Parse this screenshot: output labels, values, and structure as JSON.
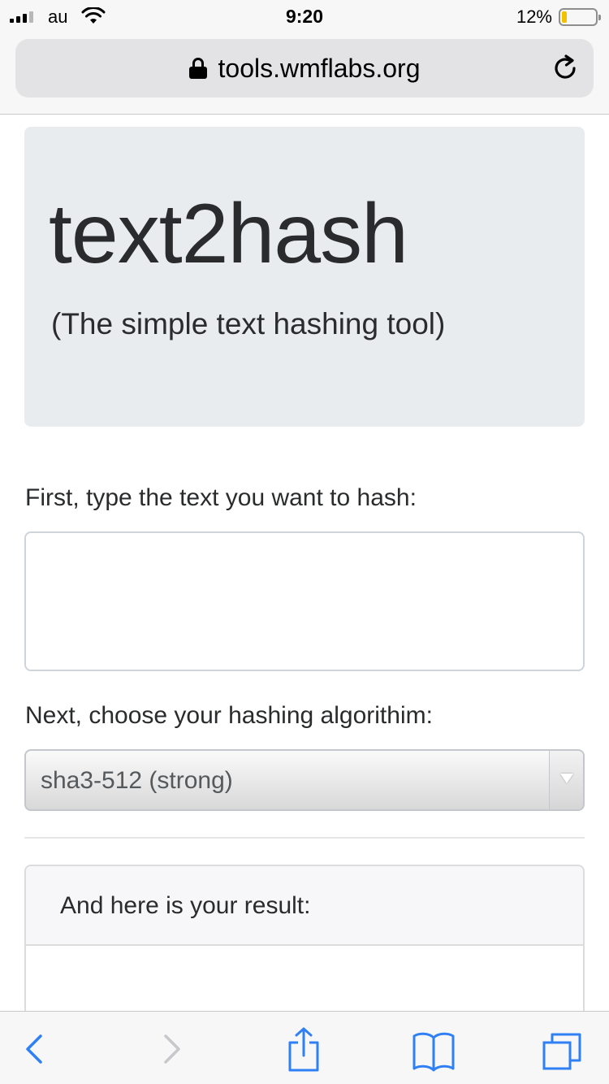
{
  "status_bar": {
    "carrier": "au",
    "time": "9:20",
    "battery_percent": "12%",
    "battery_level": 0.12
  },
  "browser": {
    "url": "tools.wmflabs.org"
  },
  "page": {
    "title": "text2hash",
    "subtitle": "(The simple text hashing tool)",
    "input_label": "First, type the text you want to hash:",
    "input_value": "",
    "algorithm_label": "Next, choose your hashing algorithim:",
    "algorithm_selected": "sha3-512 (strong)",
    "result_label": "And here is your result:",
    "result_value": ""
  },
  "colors": {
    "accent": "#2f7ff5",
    "accent_disabled": "#c7c7cc",
    "jumbotron_bg": "#e9ecef",
    "battery_low": "#f2c200"
  },
  "icons": {
    "back": "chevron-left-icon",
    "forward": "chevron-right-icon",
    "share": "share-icon",
    "bookmarks": "book-icon",
    "tabs": "tabs-icon",
    "reload": "reload-icon",
    "lock": "lock-icon"
  }
}
